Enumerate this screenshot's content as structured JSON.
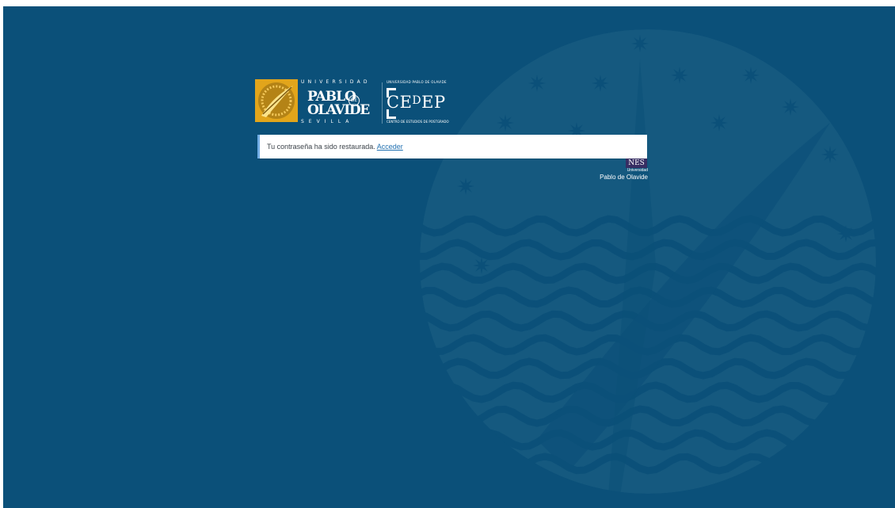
{
  "logos": {
    "upo": {
      "top": "UNIVERSIDAD",
      "line1": "PABLO",
      "de": "DE",
      "line2": "OLAVIDE",
      "bottom": "SEVILLA"
    },
    "cedep": {
      "top": "UNIVERSIDAD PABLO DE OLAVIDE",
      "mark_left": "CE",
      "mark_d": "D",
      "mark_right": "EP",
      "bottom": "CENTRO DE ESTUDIOS DE POSTGRADO"
    }
  },
  "message": {
    "text": "Tu contraseña ha sido restaurada.",
    "link": "Acceder"
  },
  "footer_logo": {
    "badge": "NES",
    "line1": "Universidad",
    "line2": "Pablo de Olavide"
  },
  "colors": {
    "background": "#0b5079",
    "seal": "#15597f",
    "message_border": "#72aee6",
    "link": "#2271b1",
    "emblem": "#e2a51b"
  }
}
